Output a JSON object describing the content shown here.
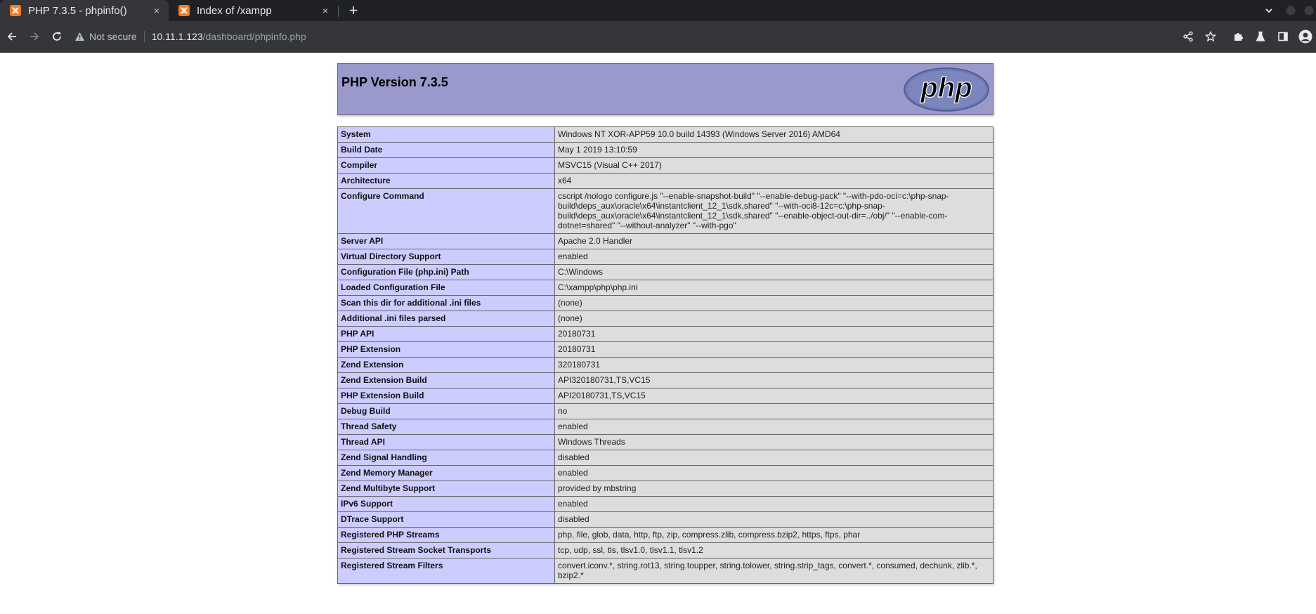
{
  "browser": {
    "tabs": [
      {
        "title": "PHP 7.3.5 - phpinfo()",
        "active": true,
        "close": "×"
      },
      {
        "title": "Index of /xampp",
        "active": false,
        "close": "×"
      }
    ],
    "new_tab": "+",
    "toolbar": {
      "security_label": "Not secure",
      "url_host": "10.11.1.123",
      "url_path": "/dashboard/phpinfo.php"
    },
    "icons": {
      "back": "back-arrow-icon",
      "forward": "forward-arrow-icon",
      "reload": "reload-icon",
      "warning": "warning-triangle-icon",
      "share": "share-icon",
      "bookmark": "star-icon",
      "extensions": "puzzle-icon",
      "labs": "flask-icon",
      "side_panel": "side-panel-icon",
      "profile": "profile-avatar-icon"
    },
    "favicon_color": "#fb7a24"
  },
  "phpinfo": {
    "header_title": "PHP Version 7.3.5",
    "logo_text": "php",
    "rows": [
      {
        "label": "System",
        "value": "Windows NT XOR-APP59 10.0 build 14393 (Windows Server 2016) AMD64"
      },
      {
        "label": "Build Date",
        "value": "May 1 2019 13:10:59"
      },
      {
        "label": "Compiler",
        "value": "MSVC15 (Visual C++ 2017)"
      },
      {
        "label": "Architecture",
        "value": "x64"
      },
      {
        "label": "Configure Command",
        "value": "cscript /nologo configure.js \"--enable-snapshot-build\" \"--enable-debug-pack\" \"--with-pdo-oci=c:\\php-snap-build\\deps_aux\\oracle\\x64\\instantclient_12_1\\sdk,shared\" \"--with-oci8-12c=c:\\php-snap-build\\deps_aux\\oracle\\x64\\instantclient_12_1\\sdk,shared\" \"--enable-object-out-dir=../obj/\" \"--enable-com-dotnet=shared\" \"--without-analyzer\" \"--with-pgo\""
      },
      {
        "label": "Server API",
        "value": "Apache 2.0 Handler"
      },
      {
        "label": "Virtual Directory Support",
        "value": "enabled"
      },
      {
        "label": "Configuration File (php.ini) Path",
        "value": "C:\\Windows"
      },
      {
        "label": "Loaded Configuration File",
        "value": "C:\\xampp\\php\\php.ini"
      },
      {
        "label": "Scan this dir for additional .ini files",
        "value": "(none)"
      },
      {
        "label": "Additional .ini files parsed",
        "value": "(none)"
      },
      {
        "label": "PHP API",
        "value": "20180731"
      },
      {
        "label": "PHP Extension",
        "value": "20180731"
      },
      {
        "label": "Zend Extension",
        "value": "320180731"
      },
      {
        "label": "Zend Extension Build",
        "value": "API320180731,TS,VC15"
      },
      {
        "label": "PHP Extension Build",
        "value": "API20180731,TS,VC15"
      },
      {
        "label": "Debug Build",
        "value": "no"
      },
      {
        "label": "Thread Safety",
        "value": "enabled"
      },
      {
        "label": "Thread API",
        "value": "Windows Threads"
      },
      {
        "label": "Zend Signal Handling",
        "value": "disabled"
      },
      {
        "label": "Zend Memory Manager",
        "value": "enabled"
      },
      {
        "label": "Zend Multibyte Support",
        "value": "provided by mbstring"
      },
      {
        "label": "IPv6 Support",
        "value": "enabled"
      },
      {
        "label": "DTrace Support",
        "value": "disabled"
      },
      {
        "label": "Registered PHP Streams",
        "value": "php, file, glob, data, http, ftp, zip, compress.zlib, compress.bzip2, https, ftps, phar"
      },
      {
        "label": "Registered Stream Socket Transports",
        "value": "tcp, udp, ssl, tls, tlsv1.0, tlsv1.1, tlsv1.2"
      },
      {
        "label": "Registered Stream Filters",
        "value": "convert.iconv.*, string.rot13, string.toupper, string.tolower, string.strip_tags, convert.*, consumed, dechunk, zlib.*, bzip2.*"
      }
    ]
  }
}
